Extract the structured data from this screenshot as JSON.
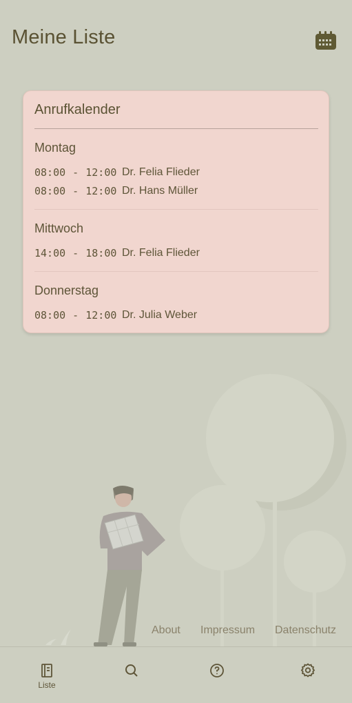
{
  "header": {
    "title": "Meine Liste",
    "calendar_icon": "calendar-icon"
  },
  "card": {
    "title": "Anrufkalender",
    "days": [
      {
        "day": "Montag",
        "slots": [
          {
            "time": "08:00 - 12:00",
            "doctor": "Dr. Felia Flieder"
          },
          {
            "time": "08:00 - 12:00",
            "doctor": "Dr. Hans Müller"
          }
        ]
      },
      {
        "day": "Mittwoch",
        "slots": [
          {
            "time": "14:00 - 18:00",
            "doctor": "Dr. Felia Flieder"
          }
        ]
      },
      {
        "day": "Donnerstag",
        "slots": [
          {
            "time": "08:00 - 12:00",
            "doctor": "Dr. Julia Weber"
          }
        ]
      }
    ]
  },
  "footer": {
    "about": "About",
    "impressum": "Impressum",
    "datenschutz": "Datenschutz"
  },
  "nav": {
    "items": [
      {
        "label": "Liste",
        "icon": "notebook-icon",
        "active": true
      },
      {
        "label": "",
        "icon": "search-icon",
        "active": false
      },
      {
        "label": "",
        "icon": "help-icon",
        "active": false
      },
      {
        "label": "",
        "icon": "settings-icon",
        "active": false
      }
    ]
  },
  "colors": {
    "background": "#cdcfc1",
    "card": "#f1d6cf",
    "text": "#5a5233"
  }
}
